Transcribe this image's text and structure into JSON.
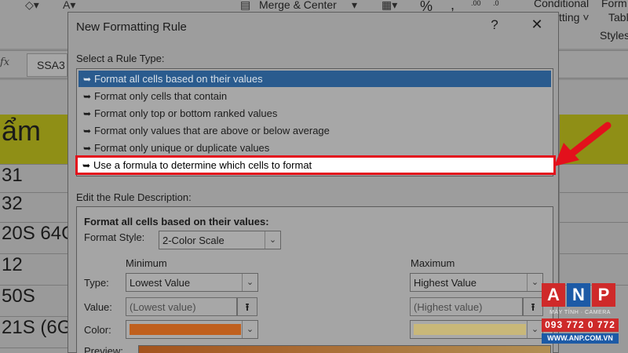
{
  "ribbon": {
    "merge_center": "Merge & Center",
    "conditional_line1": "Conditional",
    "conditional_line2": "Formatting",
    "format_line1": "Form",
    "table_line2": "Tabl",
    "styles_group": "Styles",
    "percent": "%",
    "comma": ",",
    "dec_increase": ".00",
    "dec_decrease": ".0"
  },
  "formula_bar": {
    "fx": "fx",
    "name_box": "SSA3"
  },
  "sheet": {
    "col_a_cells": [
      "ẩm",
      "31",
      "32",
      "20S 64G",
      "12",
      "50S",
      "21S (6G"
    ]
  },
  "dialog": {
    "title": "New Formatting Rule",
    "help": "?",
    "close": "✕",
    "rule_type_label": "Select a Rule Type:",
    "rule_types": [
      "Format all cells based on their values",
      "Format only cells that contain",
      "Format only top or bottom ranked values",
      "Format only values that are above or below average",
      "Format only unique or duplicate values",
      "Use a formula to determine which cells to format"
    ],
    "rule_marker": "➥",
    "edit_label": "Edit the Rule Description:",
    "desc_heading": "Format all cells based on their values:",
    "format_style_label": "Format Style:",
    "format_style_value": "2-Color Scale",
    "minimum_label": "Minimum",
    "maximum_label": "Maximum",
    "type_label": "Type:",
    "value_label": "Value:",
    "color_label": "Color:",
    "preview_label": "Preview:",
    "min_type": "Lowest Value",
    "max_type": "Highest Value",
    "min_value_placeholder": "(Lowest value)",
    "max_value_placeholder": "(Highest value)",
    "min_color": "#c0601e",
    "max_color": "#c9b879",
    "dropdown_glyph": "⌄",
    "pick_glyph": "⭱"
  },
  "watermark": {
    "letters": [
      "A",
      "N",
      "P"
    ],
    "letter_colors": [
      "#cf2a2a",
      "#1c5aa6",
      "#cf2a2a"
    ],
    "subtitle": "MÁY TÍNH · CAMERA",
    "phone": "093 772 0 772",
    "url": "WWW.ANP.COM.VN"
  }
}
